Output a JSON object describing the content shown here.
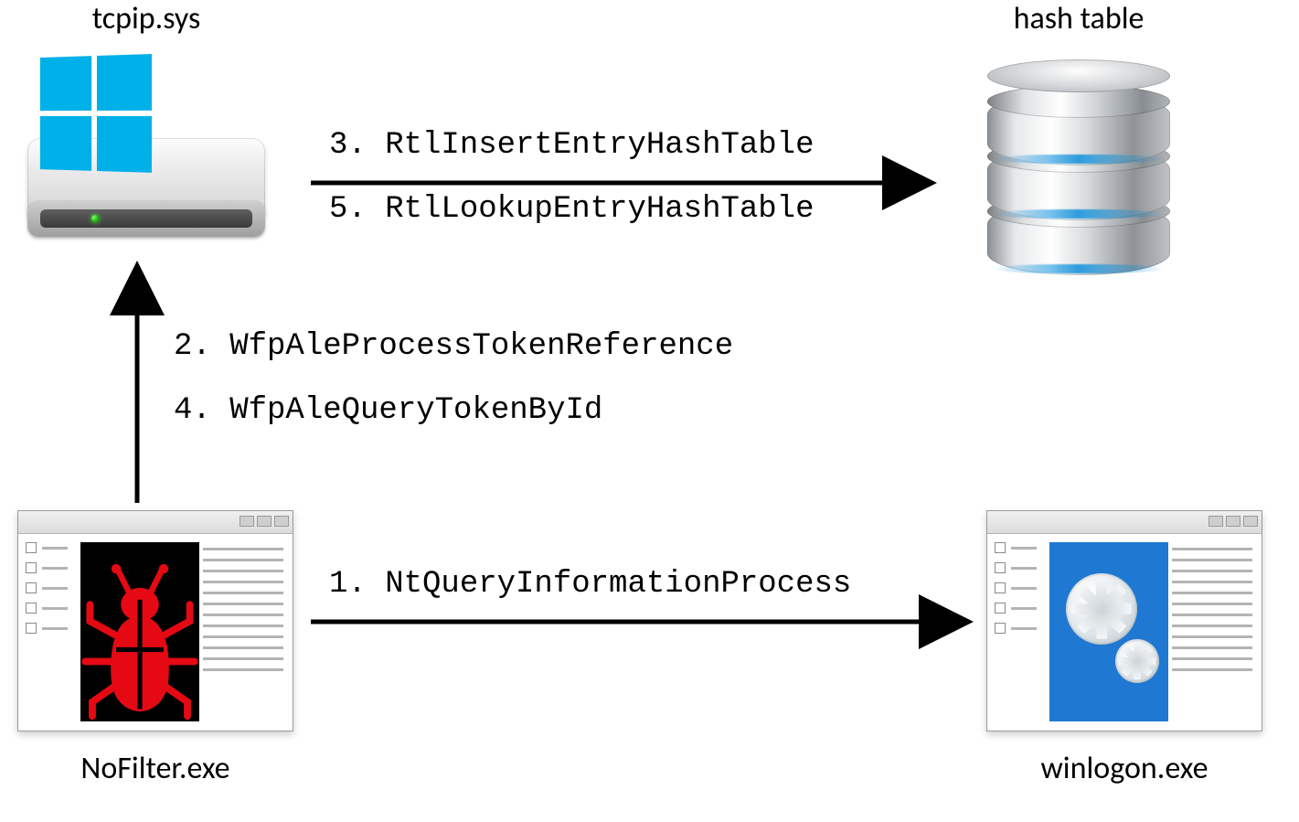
{
  "nodes": {
    "top_left_label": "tcpip.sys",
    "top_right_label": "hash table",
    "bottom_left_label": "NoFilter.exe",
    "bottom_right_label": "winlogon.exe"
  },
  "arrows": {
    "top_horizontal": {
      "line1": "3. RtlInsertEntryHashTable",
      "line2": "5. RtlLookupEntryHashTable"
    },
    "vertical": {
      "line1": "2. WfpAleProcessTokenReference",
      "line2": "4. WfpAleQueryTokenById"
    },
    "bottom_horizontal": {
      "line1": "1. NtQueryInformationProcess"
    }
  },
  "icons": {
    "driver": "windows-driver-icon",
    "database": "database-cylinder-icon",
    "malware": "bug-malware-icon",
    "settings": "gear-settings-icon"
  },
  "colors": {
    "windows_blue": "#00b0e8",
    "app_blue": "#1f78d1",
    "bug_red": "#e50914"
  }
}
